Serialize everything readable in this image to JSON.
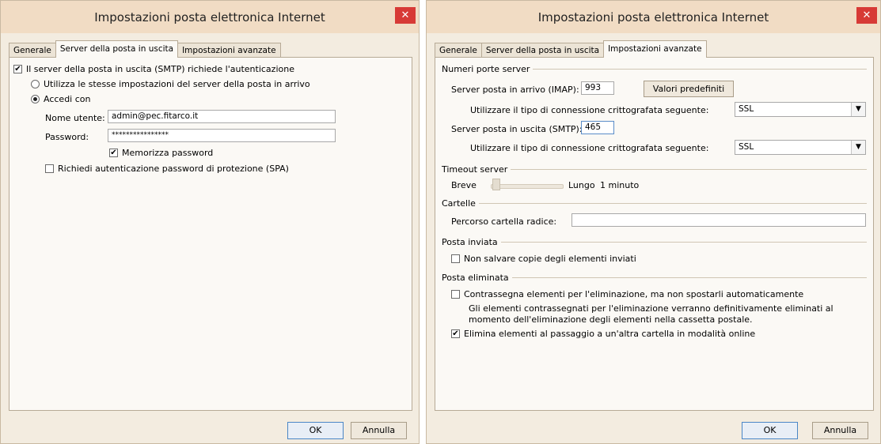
{
  "dialog1": {
    "title": "Impostazioni posta elettronica Internet",
    "close_label": "✕",
    "tabs": [
      "Generale",
      "Server della posta in uscita",
      "Impostazioni avanzate"
    ],
    "smtp_auth_label": "Il server della posta in uscita (SMTP) richiede l'autenticazione",
    "smtp_auth_checked": true,
    "same_settings_label": "Utilizza le stesse impostazioni del server della posta in arrivo",
    "login_with_label": "Accedi con",
    "username_label": "Nome utente:",
    "username_value": "admin@pec.fitarco.it",
    "password_label": "Password:",
    "password_value": "****************",
    "remember_password_label": "Memorizza password",
    "spa_label": "Richiedi autenticazione password di protezione (SPA)",
    "ok_label": "OK",
    "cancel_label": "Annulla"
  },
  "dialog2": {
    "title": "Impostazioni posta elettronica Internet",
    "close_label": "✕",
    "tabs": [
      "Generale",
      "Server della posta in uscita",
      "Impostazioni avanzate"
    ],
    "ports_group": "Numeri porte server",
    "incoming_label": "Server posta in arrivo (IMAP):",
    "incoming_port": "993",
    "defaults_button": "Valori predefiniti",
    "encryption_label_1": "Utilizzare il tipo di connessione crittografata seguente:",
    "encryption_value_1": "SSL",
    "outgoing_label": "Server posta in uscita (SMTP):",
    "outgoing_port": "465",
    "encryption_label_2": "Utilizzare il tipo di connessione crittografata seguente:",
    "encryption_value_2": "SSL",
    "timeout_group": "Timeout server",
    "timeout_short": "Breve",
    "timeout_long": "Lungo",
    "timeout_value": "1 minuto",
    "folders_group": "Cartelle",
    "root_folder_label": "Percorso cartella radice:",
    "root_folder_value": "",
    "sent_group": "Posta inviata",
    "no_sent_copies_label": "Non salvare copie degli elementi inviati",
    "deleted_group": "Posta eliminata",
    "mark_delete_label": "Contrassegna elementi per l'eliminazione, ma non spostarli automaticamente",
    "mark_delete_note_1": "Gli elementi contrassegnati per l'eliminazione verranno definitivamente eliminati al",
    "mark_delete_note_2": "momento dell'eliminazione degli elementi nella cassetta postale.",
    "purge_label": "Elimina elementi al passaggio a un'altra cartella in modalità online",
    "ok_label": "OK",
    "cancel_label": "Annulla"
  }
}
